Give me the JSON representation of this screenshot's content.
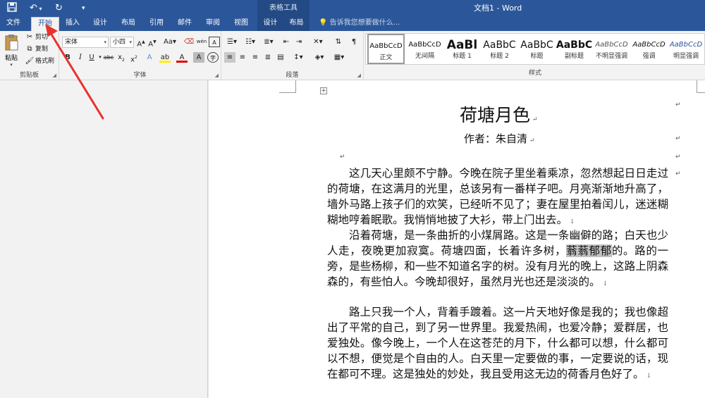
{
  "title_bar": {
    "doc_title": "文档1 - Word",
    "context_title": "表格工具",
    "save_icon": "save-icon",
    "undo_icon": "undo-icon",
    "redo_icon": "redo-icon"
  },
  "tabs": [
    {
      "label": "文件"
    },
    {
      "label": "开始"
    },
    {
      "label": "插入"
    },
    {
      "label": "设计"
    },
    {
      "label": "布局"
    },
    {
      "label": "引用"
    },
    {
      "label": "邮件"
    },
    {
      "label": "审阅"
    },
    {
      "label": "视图"
    },
    {
      "label": "设计"
    },
    {
      "label": "布局"
    }
  ],
  "tell_me": "告诉我您想要做什么...",
  "clipboard": {
    "paste_label": "粘贴",
    "cut_label": "剪切",
    "copy_label": "复制",
    "format_painter_label": "格式刷",
    "group_label": "剪贴板"
  },
  "font": {
    "font_name": "宋体",
    "font_size": "小四",
    "group_label": "字体"
  },
  "paragraph": {
    "group_label": "段落"
  },
  "styles": {
    "group_label": "样式",
    "items": [
      {
        "preview": "AaBbCcD",
        "name": "正文"
      },
      {
        "preview": "AaBbCcD",
        "name": "无间隔"
      },
      {
        "preview": "AaBl",
        "name": "标题 1"
      },
      {
        "preview": "AaBbC",
        "name": "标题 2"
      },
      {
        "preview": "AaBbC",
        "name": "标题"
      },
      {
        "preview": "AaBbC",
        "name": "副标题"
      },
      {
        "preview": "AaBbCcD",
        "name": "不明显强调"
      },
      {
        "preview": "AaBbCcD",
        "name": "强调"
      },
      {
        "preview": "AaBbCcD",
        "name": "明显强调"
      }
    ]
  },
  "document": {
    "title": "荷塘月色",
    "author": "作者：朱自清",
    "paragraphs": [
      {
        "before": "这几天心里颇不宁静。今晚在院子里坐着乘凉，忽然想起日日走过的荷塘，在这满月的光里，总该另有一番样子吧。月亮渐渐地升高了，墙外马路上孩子们的欢笑，已经听不见了；妻在屋里拍着闰儿，迷迷糊糊地哼着眠歌。我悄悄地披了大衫，带上门出去。",
        "highlight": "",
        "after": ""
      },
      {
        "before": "沿着荷塘，是一条曲折的小煤屑路。这是一条幽僻的路；白天也少人走，夜晚更加寂寞。荷塘四面，长着许多树，",
        "highlight": "蓊蓊郁郁",
        "after": "的。路的一旁，是些杨柳，和一些不知道名字的树。没有月光的晚上，这路上阴森森的，有些怕人。今晚却很好，虽然月光也还是淡淡的。"
      },
      {
        "before": "路上只我一个人，背着手踱着。这一片天地好像是我的；我也像超出了平常的自己，到了另一世界里。我爱热闹，也爱冷静；爱群居，也爱独处。像今晚上，一个人在这苍茫的月下，什么都可以想，什么都可以不想，便觉是个自由的人。白天里一定要做的事，一定要说的话，现在都可不理。这是独处的妙处，我且受用这无边的荷香月色好了。",
        "highlight": "",
        "after": ""
      }
    ]
  }
}
